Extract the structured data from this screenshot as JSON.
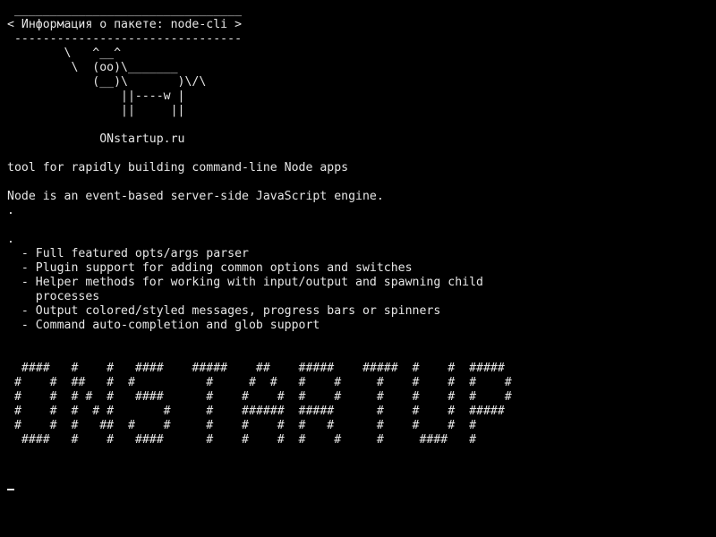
{
  "terminal": {
    "lines": [
      " ________________________________",
      "< Информация о пакете: node-cli >",
      " --------------------------------",
      "        \\   ^__^",
      "         \\  (oo)\\_______",
      "            (__)\\       )\\/\\",
      "                ||----w |",
      "                ||     ||",
      "",
      "             ONstartup.ru",
      "",
      "tool for rapidly building command-line Node apps",
      "",
      "Node is an event-based server-side JavaScript engine.",
      ".",
      "",
      ".",
      "  - Full featured opts/args parser",
      "  - Plugin support for adding common options and switches",
      "  - Helper methods for working with input/output and spawning child",
      "    processes",
      "  - Output colored/styled messages, progress bars or spinners",
      "  - Command auto-completion and glob support",
      "",
      "",
      "  ####   #    #   ####    #####    ##    #####    #####  #    #  #####",
      " #    #  ##   #  #          #     #  #   #    #     #    #    #  #    #",
      " #    #  # #  #   ####      #    #    #  #    #     #    #    #  #    #",
      " #    #  #  # #       #     #    ######  #####      #    #    #  #####",
      " #    #  #   ##  #    #     #    #    #  #   #      #    #    #  #",
      "  ####   #    #   ####      #    #    #  #    #     #     ####   #",
      "",
      ""
    ]
  }
}
